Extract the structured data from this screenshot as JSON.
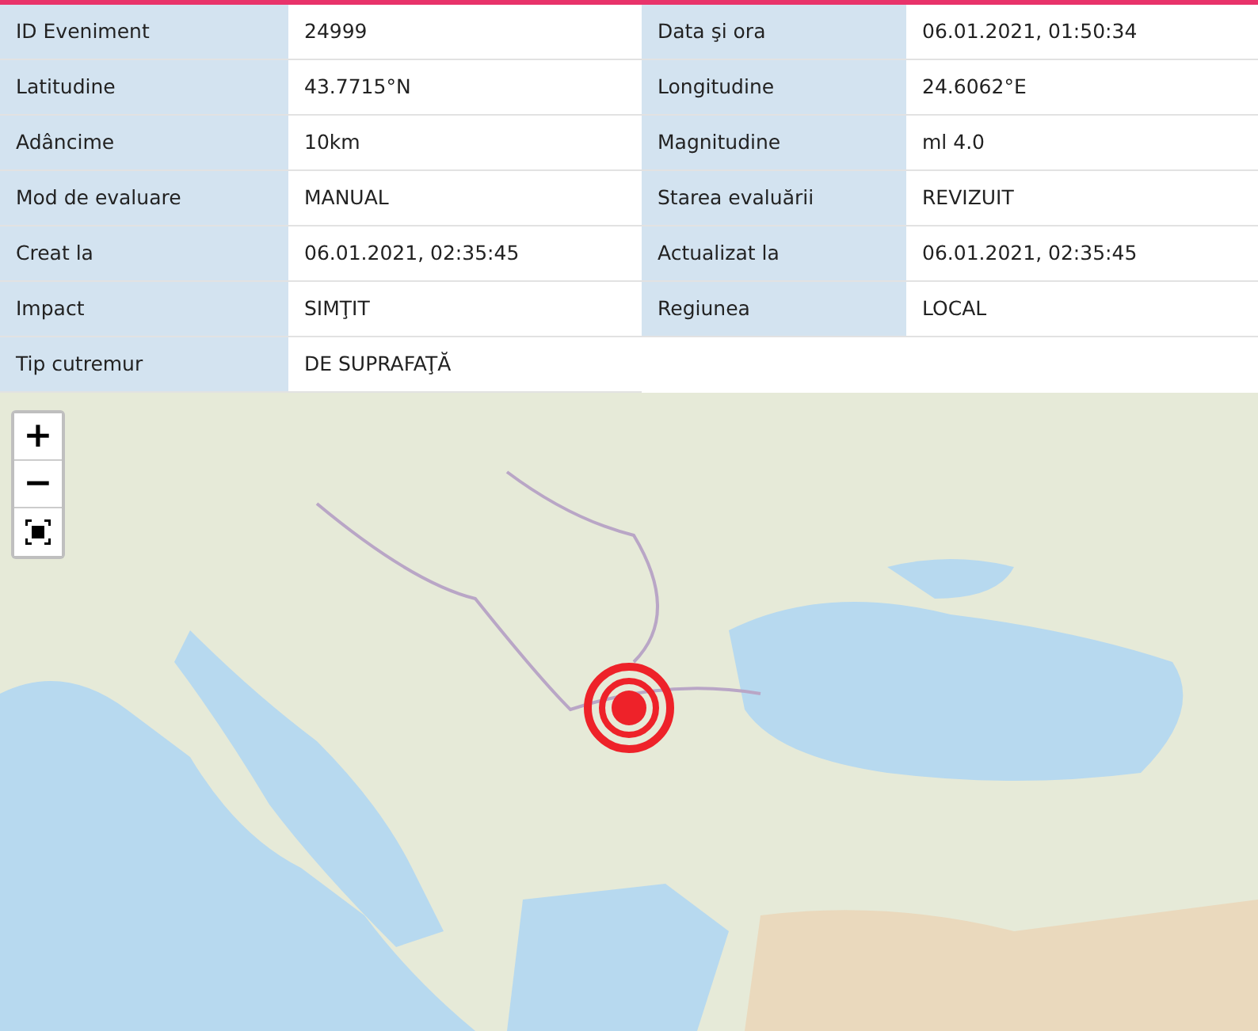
{
  "details": {
    "rows": [
      {
        "pairs": [
          {
            "label": "ID Eveniment",
            "value": "24999"
          },
          {
            "label": "Data şi ora",
            "value": "06.01.2021, 01:50:34"
          }
        ]
      },
      {
        "pairs": [
          {
            "label": "Latitudine",
            "value": "43.7715°N"
          },
          {
            "label": "Longitudine",
            "value": "24.6062°E"
          }
        ]
      },
      {
        "pairs": [
          {
            "label": "Adâncime",
            "value": "10km"
          },
          {
            "label": "Magnitudine",
            "value": "ml 4.0"
          }
        ]
      },
      {
        "pairs": [
          {
            "label": "Mod de evaluare",
            "value": "MANUAL"
          },
          {
            "label": "Starea evaluării",
            "value": "REVIZUIT"
          }
        ]
      },
      {
        "pairs": [
          {
            "label": "Creat la",
            "value": "06.01.2021, 02:35:45"
          },
          {
            "label": "Actualizat la",
            "value": "06.01.2021, 02:35:45"
          }
        ]
      },
      {
        "pairs": [
          {
            "label": "Impact",
            "value": "SIMŢIT"
          },
          {
            "label": "Regiunea",
            "value": "LOCAL"
          }
        ]
      },
      {
        "pairs": [
          {
            "label": "Tip cutremur",
            "value": "DE SUPRAFAŢĂ"
          }
        ]
      }
    ]
  },
  "map": {
    "zoom_in": "+",
    "zoom_out": "−"
  }
}
